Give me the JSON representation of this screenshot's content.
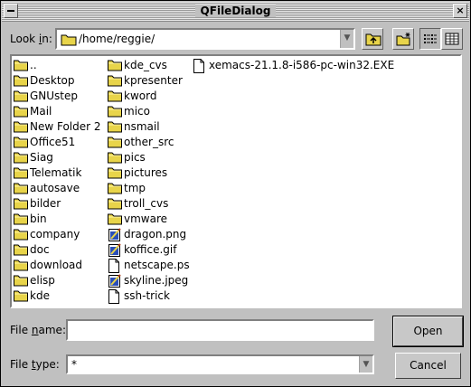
{
  "window": {
    "title": "QFileDialog"
  },
  "look_in": {
    "label_before": "Look ",
    "label_accel": "i",
    "label_after": "n:",
    "path": "/home/reggie/"
  },
  "toolbar": {
    "icons": [
      "folder-up-icon",
      "new-folder-icon",
      "list-view-icon",
      "detail-view-icon"
    ]
  },
  "files": {
    "column1": [
      {
        "name": "..",
        "type": "folder"
      },
      {
        "name": "Desktop",
        "type": "folder"
      },
      {
        "name": "GNUstep",
        "type": "folder"
      },
      {
        "name": "Mail",
        "type": "folder"
      },
      {
        "name": "New Folder 2",
        "type": "folder"
      },
      {
        "name": "Office51",
        "type": "folder"
      },
      {
        "name": "Siag",
        "type": "folder"
      },
      {
        "name": "Telematik",
        "type": "folder"
      },
      {
        "name": "autosave",
        "type": "folder"
      },
      {
        "name": "bilder",
        "type": "folder"
      },
      {
        "name": "bin",
        "type": "folder"
      },
      {
        "name": "company",
        "type": "folder"
      },
      {
        "name": "doc",
        "type": "folder"
      },
      {
        "name": "download",
        "type": "folder"
      },
      {
        "name": "elisp",
        "type": "folder"
      },
      {
        "name": "kde",
        "type": "folder"
      }
    ],
    "column2": [
      {
        "name": "kde_cvs",
        "type": "folder"
      },
      {
        "name": "kpresenter",
        "type": "folder"
      },
      {
        "name": "kword",
        "type": "folder"
      },
      {
        "name": "mico",
        "type": "folder"
      },
      {
        "name": "nsmail",
        "type": "folder"
      },
      {
        "name": "other_src",
        "type": "folder"
      },
      {
        "name": "pics",
        "type": "folder"
      },
      {
        "name": "pictures",
        "type": "folder"
      },
      {
        "name": "tmp",
        "type": "folder"
      },
      {
        "name": "troll_cvs",
        "type": "folder"
      },
      {
        "name": "vmware",
        "type": "folder"
      },
      {
        "name": "dragon.png",
        "type": "image"
      },
      {
        "name": "koffice.gif",
        "type": "image"
      },
      {
        "name": "netscape.ps",
        "type": "file"
      },
      {
        "name": "skyline.jpeg",
        "type": "image"
      },
      {
        "name": "ssh-trick",
        "type": "file"
      }
    ],
    "column3": [
      {
        "name": "xemacs-21.1.8-i586-pc-win32.EXE",
        "type": "file"
      }
    ]
  },
  "file_name": {
    "label_before": "File ",
    "label_accel": "n",
    "label_after": "ame:",
    "value": ""
  },
  "file_type": {
    "label_before": "File ",
    "label_accel": "t",
    "label_after": "ype:",
    "value": "*"
  },
  "buttons": {
    "open": "Open",
    "cancel": "Cancel"
  },
  "colors": {
    "dialog_bg": "#c0c0c0",
    "folder_yellow": "#e8d44a",
    "list_bg": "#ffffff"
  }
}
